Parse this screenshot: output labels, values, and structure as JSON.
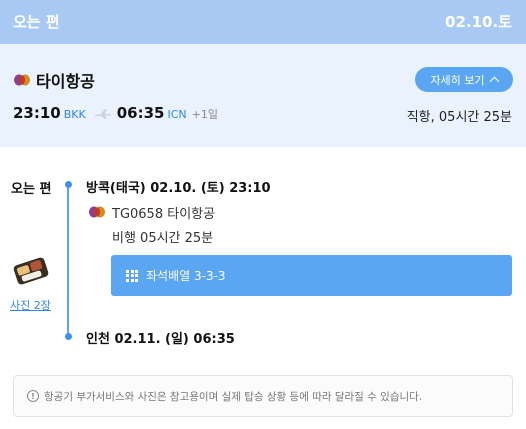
{
  "header": {
    "title": "오는 편",
    "date": "02.10.토"
  },
  "summary": {
    "airline": "타이항공",
    "detail_button": "자세히 보기",
    "departure_time": "23:10",
    "departure_code": "BKK",
    "arrival_time": "06:35",
    "arrival_code": "ICN",
    "day_offset": "+1일",
    "duration": "직항, 05시간 25분"
  },
  "detail": {
    "side_label": "오는 편",
    "departure": "방콕(태국) 02.10. (토) 23:10",
    "flight": "TG0658 타이항공",
    "flight_duration": "비행 05시간 25분",
    "seat_config": "좌석배열 3-3-3",
    "photo_link": "사진 2장",
    "arrival": "인천 02.11. (일) 06:35"
  },
  "notice": {
    "text": "항공기 부가서비스와 사진은 참고용이며 실제 탑승 상황 등에 따라 달라질 수 있습니다."
  },
  "icons": {
    "airline_logo": "thai-airways-logo",
    "plane": "airplane-icon",
    "seat": "seat-grid-icon",
    "info": "info-icon",
    "chevron": "chevron-up-icon",
    "meal": "meal-photo-thumbnail"
  },
  "colors": {
    "header_bg": "#a9c9f5",
    "summary_bg": "#eaf3fd",
    "accent": "#5ba6f2",
    "link": "#2f86e4"
  }
}
